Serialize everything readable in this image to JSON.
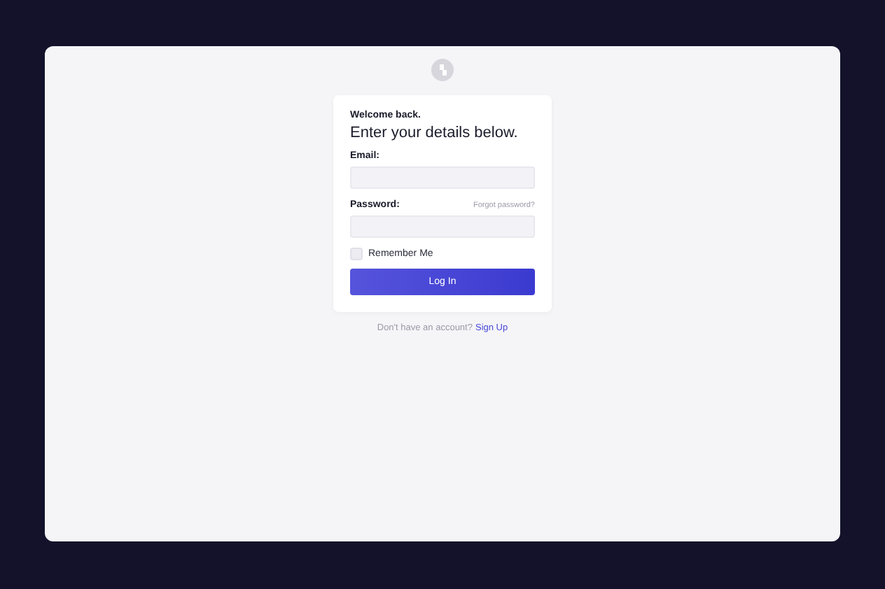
{
  "card": {
    "greeting": "Welcome back.",
    "heading": "Enter your details below.",
    "email": {
      "label": "Email:"
    },
    "password": {
      "label": "Password:",
      "link": "Forgot password?"
    },
    "remember": {
      "label": "Remember Me",
      "checked": false
    },
    "submit": "Log In"
  },
  "footer": {
    "text": "Don't have an account?",
    "link": "Sign Up"
  }
}
